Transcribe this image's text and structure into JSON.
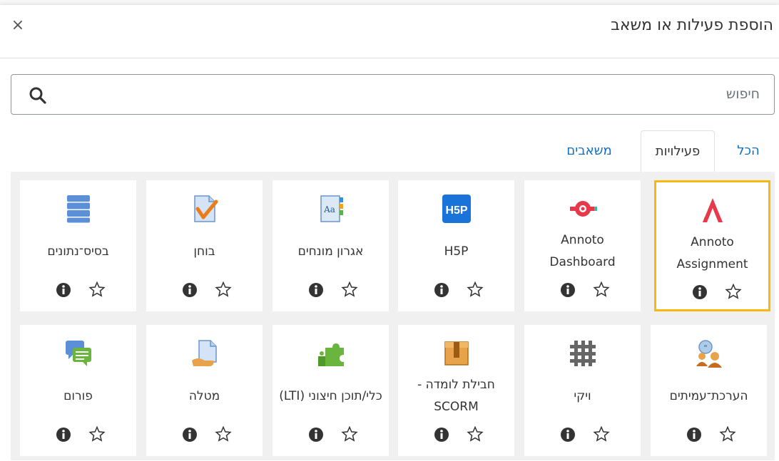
{
  "dialog": {
    "title": "הוספת פעילות או משאב",
    "close_glyph": "×"
  },
  "search": {
    "placeholder": "חיפוש"
  },
  "tabs": [
    {
      "label": "הכל",
      "active": false
    },
    {
      "label": "פעילויות",
      "active": true
    },
    {
      "label": "משאבים",
      "active": false
    }
  ],
  "colors": {
    "accent": "#0f6fc5",
    "selected_border": "#f6b90f",
    "h5p_blue": "#1a73d9",
    "annoto_red": "#e8394b"
  },
  "cards": [
    {
      "label": "Annoto Assignment",
      "icon": "annoto-assignment-icon",
      "selected": true
    },
    {
      "label": "Annoto Dashboard",
      "icon": "annoto-dashboard-icon",
      "selected": false
    },
    {
      "label": "H5P",
      "icon": "h5p-icon",
      "selected": false
    },
    {
      "label": "אגרון מונחים",
      "icon": "glossary-icon",
      "selected": false
    },
    {
      "label": "בוחן",
      "icon": "quiz-icon",
      "selected": false
    },
    {
      "label": "בסיס־נתונים",
      "icon": "database-icon",
      "selected": false
    },
    {
      "label": "הערכת־עמיתים",
      "icon": "workshop-icon",
      "selected": false
    },
    {
      "label": "ויקי",
      "icon": "wiki-icon",
      "selected": false
    },
    {
      "label": "חבילת לומדה - SCORM",
      "icon": "scorm-icon",
      "selected": false
    },
    {
      "label": "כלי/תוכן חיצוני (LTI)",
      "icon": "lti-icon",
      "selected": false
    },
    {
      "label": "מטלה",
      "icon": "assignment-icon",
      "selected": false
    },
    {
      "label": "פורום",
      "icon": "forum-icon",
      "selected": false
    }
  ]
}
